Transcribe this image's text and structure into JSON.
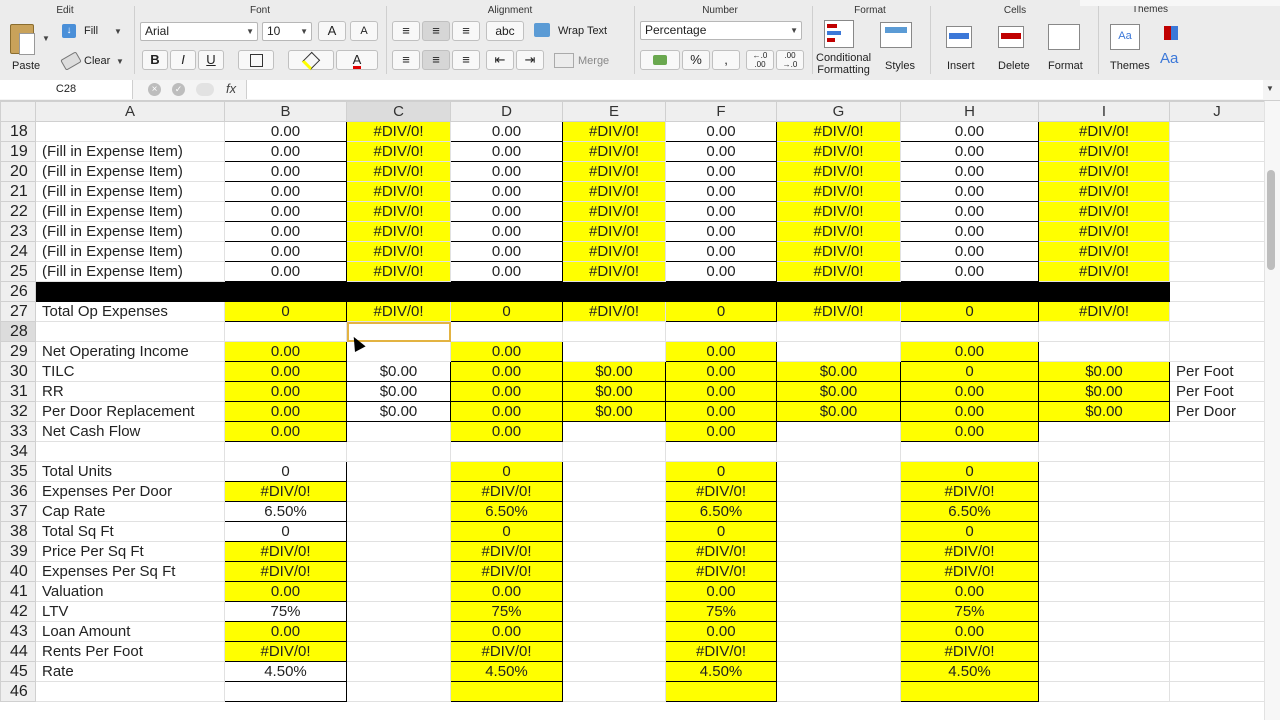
{
  "ribbon": {
    "groups": {
      "edit": "Edit",
      "font": "Font",
      "alignment": "Alignment",
      "number": "Number",
      "format": "Format",
      "cells": "Cells",
      "themes": "Themes"
    },
    "paste_label": "Paste",
    "fill_label": "Fill",
    "clear_label": "Clear",
    "font_name": "Arial",
    "font_size": "10",
    "wrap_text_label": "Wrap Text",
    "merge_label": "Merge",
    "abc_label": "abc",
    "number_format": "Percentage",
    "percent_symbol": "%",
    "comma_symbol": ",",
    "dec_increase": "←.0\n.00",
    "dec_decrease": ".00\n→.0",
    "conditional_formatting_label": "Conditional\nFormatting",
    "styles_label": "Styles",
    "insert_label": "Insert",
    "delete_label": "Delete",
    "format_label": "Format",
    "themes_label": "Themes",
    "bold": "B",
    "italic": "I",
    "underline": "U",
    "grow_font": "A",
    "shrink_font": "A",
    "font_color_letter": "A",
    "theme_fonts_label": "Aa"
  },
  "formula_bar": {
    "name_box": "C28",
    "fx": "fx",
    "formula": ""
  },
  "columns": [
    "",
    "A",
    "B",
    "C",
    "D",
    "E",
    "F",
    "G",
    "H",
    "I",
    "J"
  ],
  "selected_column": "C",
  "selected_row": "28",
  "rows": [
    {
      "n": "18",
      "c": [
        "",
        "0.00",
        "#DIV/0!",
        "0.00",
        "#DIV/0!",
        "0.00",
        "#DIV/0!",
        "0.00",
        "#DIV/0!",
        ""
      ]
    },
    {
      "n": "19",
      "c": [
        "(Fill in Expense Item)",
        "0.00",
        "#DIV/0!",
        "0.00",
        "#DIV/0!",
        "0.00",
        "#DIV/0!",
        "0.00",
        "#DIV/0!",
        ""
      ]
    },
    {
      "n": "20",
      "c": [
        "(Fill in Expense Item)",
        "0.00",
        "#DIV/0!",
        "0.00",
        "#DIV/0!",
        "0.00",
        "#DIV/0!",
        "0.00",
        "#DIV/0!",
        ""
      ]
    },
    {
      "n": "21",
      "c": [
        "(Fill in Expense Item)",
        "0.00",
        "#DIV/0!",
        "0.00",
        "#DIV/0!",
        "0.00",
        "#DIV/0!",
        "0.00",
        "#DIV/0!",
        ""
      ]
    },
    {
      "n": "22",
      "c": [
        "(Fill in Expense Item)",
        "0.00",
        "#DIV/0!",
        "0.00",
        "#DIV/0!",
        "0.00",
        "#DIV/0!",
        "0.00",
        "#DIV/0!",
        ""
      ]
    },
    {
      "n": "23",
      "c": [
        "(Fill in Expense Item)",
        "0.00",
        "#DIV/0!",
        "0.00",
        "#DIV/0!",
        "0.00",
        "#DIV/0!",
        "0.00",
        "#DIV/0!",
        ""
      ]
    },
    {
      "n": "24",
      "c": [
        "(Fill in Expense Item)",
        "0.00",
        "#DIV/0!",
        "0.00",
        "#DIV/0!",
        "0.00",
        "#DIV/0!",
        "0.00",
        "#DIV/0!",
        ""
      ]
    },
    {
      "n": "25",
      "c": [
        "(Fill in Expense Item)",
        "0.00",
        "#DIV/0!",
        "0.00",
        "#DIV/0!",
        "0.00",
        "#DIV/0!",
        "0.00",
        "#DIV/0!",
        ""
      ]
    },
    {
      "n": "26",
      "c": [
        "",
        "",
        "",
        "",
        "",
        "",
        "",
        "",
        "",
        ""
      ]
    },
    {
      "n": "27",
      "c": [
        "Total Op Expenses",
        "0",
        "#DIV/0!",
        "0",
        "#DIV/0!",
        "0",
        "#DIV/0!",
        "0",
        "#DIV/0!",
        ""
      ]
    },
    {
      "n": "28",
      "c": [
        "",
        "",
        "",
        "",
        "",
        "",
        "",
        "",
        "",
        ""
      ]
    },
    {
      "n": "29",
      "c": [
        "Net Operating Income",
        "0.00",
        "",
        "0.00",
        "",
        "0.00",
        "",
        "0.00",
        "",
        ""
      ]
    },
    {
      "n": "30",
      "c": [
        "TILC",
        "0.00",
        "$0.00",
        "0.00",
        "$0.00",
        "0.00",
        "$0.00",
        "0",
        "$0.00",
        "Per Foot"
      ]
    },
    {
      "n": "31",
      "c": [
        "RR",
        "0.00",
        "$0.00",
        "0.00",
        "$0.00",
        "0.00",
        "$0.00",
        "0.00",
        "$0.00",
        "Per Foot"
      ]
    },
    {
      "n": "32",
      "c": [
        "Per Door Replacement",
        "0.00",
        "$0.00",
        "0.00",
        "$0.00",
        "0.00",
        "$0.00",
        "0.00",
        "$0.00",
        "Per Door"
      ]
    },
    {
      "n": "33",
      "c": [
        "Net Cash Flow",
        "0.00",
        "",
        "0.00",
        "",
        "0.00",
        "",
        "0.00",
        "",
        ""
      ]
    },
    {
      "n": "34",
      "c": [
        "",
        "",
        "",
        "",
        "",
        "",
        "",
        "",
        "",
        ""
      ]
    },
    {
      "n": "35",
      "c": [
        "Total Units",
        "0",
        "",
        "0",
        "",
        "0",
        "",
        "0",
        "",
        ""
      ]
    },
    {
      "n": "36",
      "c": [
        "Expenses Per Door",
        "#DIV/0!",
        "",
        "#DIV/0!",
        "",
        "#DIV/0!",
        "",
        "#DIV/0!",
        "",
        ""
      ]
    },
    {
      "n": "37",
      "c": [
        "Cap Rate",
        "6.50%",
        "",
        "6.50%",
        "",
        "6.50%",
        "",
        "6.50%",
        "",
        ""
      ]
    },
    {
      "n": "38",
      "c": [
        "Total Sq Ft",
        "0",
        "",
        "0",
        "",
        "0",
        "",
        "0",
        "",
        ""
      ]
    },
    {
      "n": "39",
      "c": [
        "Price Per Sq Ft",
        "#DIV/0!",
        "",
        "#DIV/0!",
        "",
        "#DIV/0!",
        "",
        "#DIV/0!",
        "",
        ""
      ]
    },
    {
      "n": "40",
      "c": [
        "Expenses Per Sq Ft",
        "#DIV/0!",
        "",
        "#DIV/0!",
        "",
        "#DIV/0!",
        "",
        "#DIV/0!",
        "",
        ""
      ]
    },
    {
      "n": "41",
      "c": [
        "Valuation",
        "0.00",
        "",
        "0.00",
        "",
        "0.00",
        "",
        "0.00",
        "",
        ""
      ]
    },
    {
      "n": "42",
      "c": [
        "LTV",
        "75%",
        "",
        "75%",
        "",
        "75%",
        "",
        "75%",
        "",
        ""
      ]
    },
    {
      "n": "43",
      "c": [
        "Loan Amount",
        "0.00",
        "",
        "0.00",
        "",
        "0.00",
        "",
        "0.00",
        "",
        ""
      ]
    },
    {
      "n": "44",
      "c": [
        "Rents Per Foot",
        "#DIV/0!",
        "",
        "#DIV/0!",
        "",
        "#DIV/0!",
        "",
        "#DIV/0!",
        "",
        ""
      ]
    },
    {
      "n": "45",
      "c": [
        "Rate",
        "4.50%",
        "",
        "4.50%",
        "",
        "4.50%",
        "",
        "4.50%",
        "",
        ""
      ]
    },
    {
      "n": "46",
      "c": [
        "",
        "",
        "",
        "",
        "",
        "",
        "",
        "",
        "",
        ""
      ]
    }
  ],
  "colors": {
    "highlight": "#ffff00",
    "black_band": "#000000",
    "selection": "#e3b341"
  }
}
